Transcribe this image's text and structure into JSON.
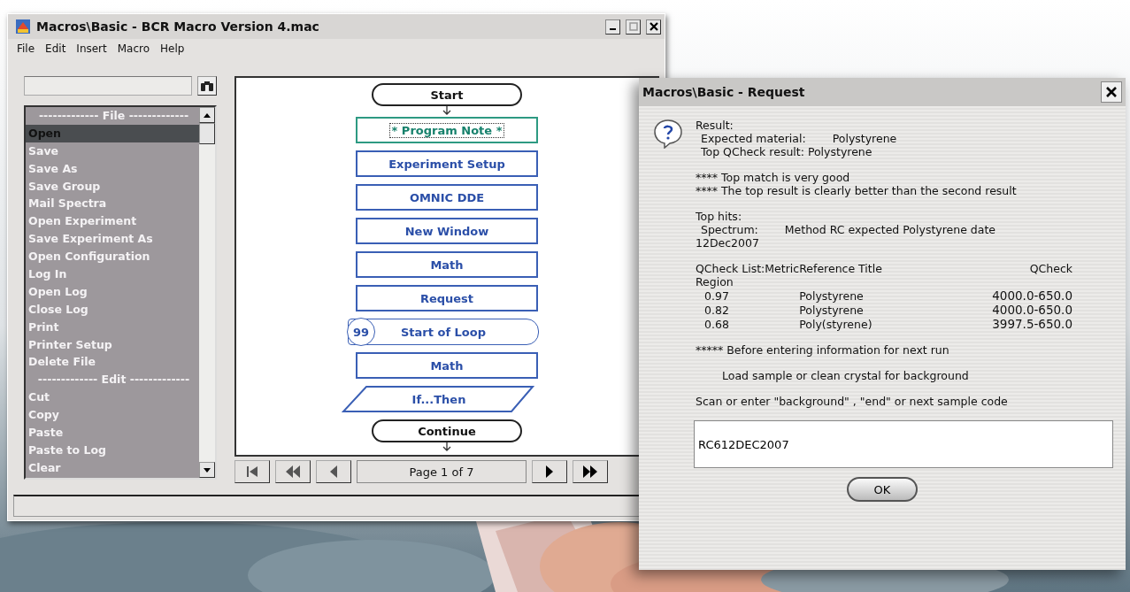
{
  "window": {
    "title": "Macros\\Basic - BCR Macro Version 4.mac",
    "menu": [
      "File",
      "Edit",
      "Insert",
      "Macro",
      "Help"
    ],
    "commands": [
      {
        "kind": "header",
        "label": "------------- File -------------",
        "selected": false
      },
      {
        "kind": "item",
        "label": "Open",
        "selected": true
      },
      {
        "kind": "item",
        "label": "Save",
        "selected": false
      },
      {
        "kind": "item",
        "label": "Save As",
        "selected": false
      },
      {
        "kind": "item",
        "label": "Save Group",
        "selected": false
      },
      {
        "kind": "item",
        "label": "Mail Spectra",
        "selected": false
      },
      {
        "kind": "item",
        "label": "Open Experiment",
        "selected": false
      },
      {
        "kind": "item",
        "label": "Save Experiment As",
        "selected": false
      },
      {
        "kind": "item",
        "label": "Open Configuration",
        "selected": false
      },
      {
        "kind": "item",
        "label": "Log In",
        "selected": false
      },
      {
        "kind": "item",
        "label": "Open Log",
        "selected": false
      },
      {
        "kind": "item",
        "label": "Close Log",
        "selected": false
      },
      {
        "kind": "item",
        "label": "Print",
        "selected": false
      },
      {
        "kind": "item",
        "label": "Printer Setup",
        "selected": false
      },
      {
        "kind": "item",
        "label": "Delete File",
        "selected": false
      },
      {
        "kind": "header",
        "label": "------------- Edit -------------",
        "selected": false
      },
      {
        "kind": "item",
        "label": "Cut",
        "selected": false
      },
      {
        "kind": "item",
        "label": "Copy",
        "selected": false
      },
      {
        "kind": "item",
        "label": "Paste",
        "selected": false
      },
      {
        "kind": "item",
        "label": "Paste to Log",
        "selected": false
      },
      {
        "kind": "item",
        "label": "Clear",
        "selected": false
      }
    ],
    "flowchart": [
      {
        "kind": "terminal",
        "label": "Start"
      },
      {
        "kind": "note",
        "label": "* Program Note  *"
      },
      {
        "kind": "process",
        "label": "Experiment Setup"
      },
      {
        "kind": "process",
        "label": "OMNIC DDE"
      },
      {
        "kind": "process",
        "label": "New Window"
      },
      {
        "kind": "process",
        "label": "Math"
      },
      {
        "kind": "process",
        "label": "Request"
      },
      {
        "kind": "loop",
        "label": "Start of Loop",
        "count": "99"
      },
      {
        "kind": "process",
        "label": "Math"
      },
      {
        "kind": "decision",
        "label": "If...Then"
      },
      {
        "kind": "terminal",
        "label": "Continue"
      }
    ],
    "pager": {
      "label": "Page 1 of 7"
    }
  },
  "dialog": {
    "title": "Macros\\Basic - Request",
    "body": [
      {
        "kind": "para",
        "lines": [
          {
            "kind": "plain",
            "parts": [
              "Result:"
            ]
          },
          {
            "kind": "indent",
            "parts": [
              "Expected material:",
              "Polystyrene"
            ]
          },
          {
            "kind": "indent",
            "parts": [
              "Top QCheck result: Polystyrene"
            ]
          }
        ]
      },
      {
        "kind": "para",
        "lines": [
          {
            "kind": "plain",
            "parts": [
              "**** Top match is very good"
            ]
          },
          {
            "kind": "plain",
            "parts": [
              "**** The top result is clearly better than the second result"
            ]
          }
        ]
      },
      {
        "kind": "para",
        "lines": [
          {
            "kind": "plain",
            "parts": [
              "Top hits:"
            ]
          },
          {
            "kind": "indent",
            "parts": [
              "Spectrum:",
              "Method RC expected  Polystyrene date"
            ]
          },
          {
            "kind": "plain",
            "parts": [
              "12Dec2007"
            ]
          }
        ]
      },
      {
        "kind": "table",
        "header": [
          "QCheck List:Metric",
          "Reference Title",
          "QCheck"
        ],
        "subheader": "Region",
        "rows": [
          [
            "0.97",
            "Polystyrene",
            "4000.0-650.0"
          ],
          [
            "0.82",
            "Polystyrene",
            "4000.0-650.0"
          ],
          [
            "0.68",
            "Poly(styrene)",
            "3997.5-650.0"
          ]
        ]
      },
      {
        "kind": "para",
        "lines": [
          {
            "kind": "plain",
            "parts": [
              "***** Before entering information for next run"
            ]
          }
        ]
      },
      {
        "kind": "para",
        "lines": [
          {
            "kind": "deep",
            "parts": [
              "Load sample or clean crystal for background"
            ]
          }
        ]
      },
      {
        "kind": "para",
        "lines": [
          {
            "kind": "plain",
            "parts": [
              "Scan or enter \"background\" , \"end\" or next sample code"
            ]
          }
        ]
      }
    ],
    "input": {
      "value": "RC612DEC2007"
    },
    "ok_button": "OK"
  }
}
